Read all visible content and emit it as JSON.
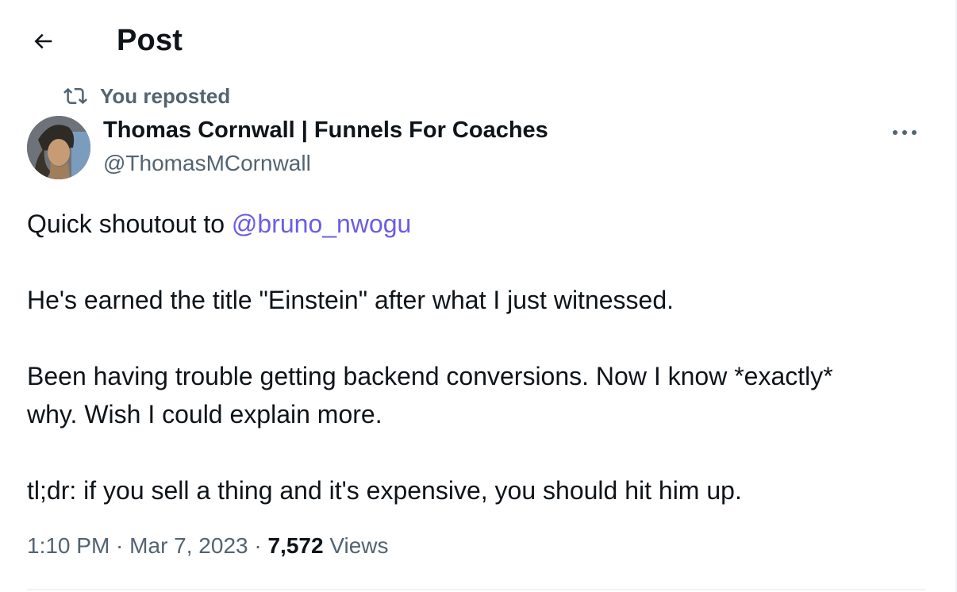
{
  "header": {
    "back_icon": "arrow-left-icon",
    "title": "Post"
  },
  "repost": {
    "icon": "repost-icon",
    "label": "You reposted"
  },
  "author": {
    "name": "Thomas Cornwall | Funnels For Coaches",
    "handle": "@ThomasMCornwall",
    "more_icon": "more-horizontal-icon"
  },
  "tweet": {
    "line1_prefix": "Quick shoutout to ",
    "mention": "@bruno_nwogu",
    "line2": "He's earned the title \"Einstein\" after what I just witnessed.",
    "line3a": "Been having trouble getting backend conversions. Now I know *exactly*",
    "line3b": "why. Wish I could explain more.",
    "line4": "tl;dr: if you sell a thing and it's expensive, you should hit him up."
  },
  "meta": {
    "time": "1:10 PM",
    "separator1": " · ",
    "date": "Mar 7, 2023",
    "separator2": " · ",
    "views_count": "7,572",
    "views_label": " Views"
  },
  "colors": {
    "text": "#0f1419",
    "secondary": "#536471",
    "mention": "#6c5ce7",
    "divider": "#eff3f4"
  }
}
